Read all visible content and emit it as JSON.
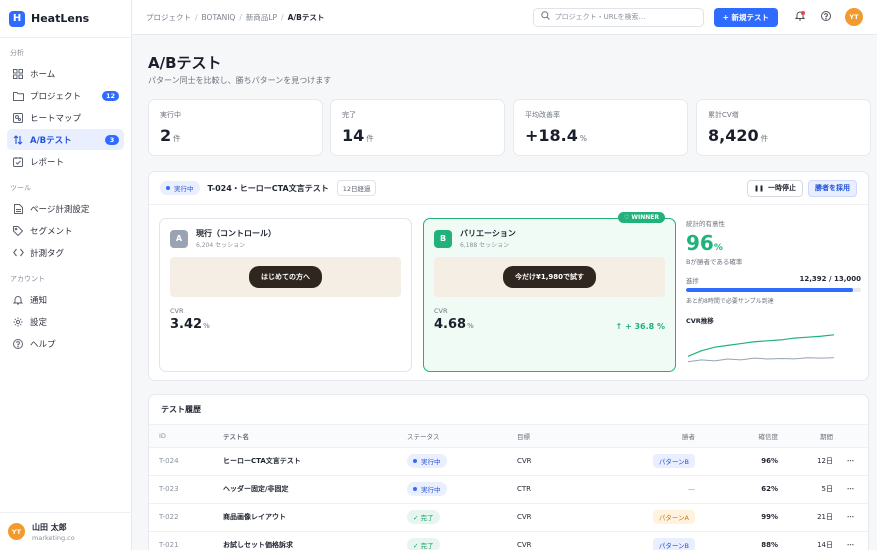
{
  "app": {
    "name": "HeatLens",
    "logo_letter": "H"
  },
  "sidebar": {
    "section_analysis": "分析",
    "section_tools": "ツール",
    "section_account": "アカウント",
    "items": [
      {
        "label": "ホーム",
        "icon": "grid-icon"
      },
      {
        "label": "プロジェクト",
        "icon": "folder-icon",
        "badge": "12"
      },
      {
        "label": "ヒートマップ",
        "icon": "heatmap-icon"
      },
      {
        "label": "A/Bテスト",
        "icon": "ab-swap-icon",
        "badge": "3",
        "active": true
      },
      {
        "label": "レポート",
        "icon": "report-icon"
      },
      {
        "label": "ページ計測設定",
        "icon": "document-icon"
      },
      {
        "label": "セグメント",
        "icon": "tag-icon"
      },
      {
        "label": "計測タグ",
        "icon": "code-icon"
      },
      {
        "label": "通知",
        "icon": "bell-icon"
      },
      {
        "label": "設定",
        "icon": "gear-icon"
      },
      {
        "label": "ヘルプ",
        "icon": "help-icon"
      }
    ],
    "user": {
      "initials": "YT",
      "name": "山田 太郎",
      "org": "marketing.co"
    }
  },
  "topbar": {
    "breadcrumbs": [
      "プロジェクト",
      "BOTANIQ",
      "新商品LP",
      "A/Bテスト"
    ],
    "search_placeholder": "プロジェクト・URLを検索…",
    "new_button": "+ 新規テスト",
    "avatar": "YT"
  },
  "page": {
    "title": "A/Bテスト",
    "subtitle": "パターン同士を比較し、勝ちパターンを見つけます"
  },
  "stats": [
    {
      "label": "実行中",
      "value": "2",
      "unit": "件"
    },
    {
      "label": "完了",
      "value": "14",
      "unit": "件"
    },
    {
      "label": "平均改善率",
      "value": "+18.4",
      "unit": "%"
    },
    {
      "label": "累計CV増",
      "value": "8,420",
      "unit": "件"
    }
  ],
  "experiment": {
    "status": "実行中",
    "title": "T-024・ヒーローCTA文言テスト",
    "days": "12日経過",
    "pause_label": "一時停止",
    "adopt_label": "勝者を採用",
    "cvr_label": "CVR",
    "variants": [
      {
        "tag": "A",
        "name": "現行（コントロール）",
        "sessions": "6,204 セッション",
        "cta": "はじめての方へ",
        "cvr": "3.42",
        "tag_color": "#9aa3b3"
      },
      {
        "tag": "B",
        "name": "バリエーション",
        "sessions": "6,188 セッション",
        "cta": "今だけ¥1,980で試す",
        "cvr": "4.68",
        "lift": "↑ + 36.8 %",
        "winner": "♡ WINNER",
        "tag_color": "#20b27a"
      }
    ],
    "significance_label": "統計的有意性",
    "significance_value": "96",
    "significance_unit": "%",
    "significance_desc": "Bが勝者である確率",
    "progress_label": "進捗",
    "progress_text": "12,392 / 13,000",
    "progress_value": 0.953,
    "progress_note": "あと約8時間で必要サンプル到達",
    "trend_label": "CVR推移"
  },
  "chart_data": {
    "type": "line",
    "title": "CVR推移",
    "x": [
      1,
      2,
      3,
      4,
      5,
      6,
      7,
      8,
      9,
      10,
      11,
      12
    ],
    "series": [
      {
        "values": [
          3.5,
          3.8,
          4.0,
          4.1,
          4.2,
          4.3,
          4.35,
          4.4,
          4.5,
          4.55,
          4.6,
          4.68
        ],
        "color": "#20b27a"
      },
      {
        "values": [
          3.2,
          3.3,
          3.25,
          3.35,
          3.3,
          3.4,
          3.35,
          3.38,
          3.36,
          3.42,
          3.4,
          3.42
        ],
        "color": "#9aa3b3"
      }
    ],
    "ylim": [
      2.8,
      5.0
    ],
    "grid": false
  },
  "history": {
    "title": "テスト履歴",
    "columns": [
      "ID",
      "テスト名",
      "ステータス",
      "目標",
      "勝者",
      "確信度",
      "期間"
    ],
    "rows": [
      {
        "id": "T-024",
        "name": "ヒーローCTA文言テスト",
        "status": "実行中",
        "status_kind": "run",
        "goal": "CVR",
        "winner": "パターンB",
        "winner_kind": "b",
        "confidence": "96%",
        "duration": "12日"
      },
      {
        "id": "T-023",
        "name": "ヘッダー固定/非固定",
        "status": "実行中",
        "status_kind": "run",
        "goal": "CTR",
        "winner": "—",
        "winner_kind": "none",
        "confidence": "62%",
        "duration": "5日"
      },
      {
        "id": "T-022",
        "name": "商品画像レイアウト",
        "status": "✓ 完了",
        "status_kind": "done",
        "goal": "CVR",
        "winner": "パターンA",
        "winner_kind": "a",
        "confidence": "99%",
        "duration": "21日"
      },
      {
        "id": "T-021",
        "name": "お試しセット価格訴求",
        "status": "✓ 完了",
        "status_kind": "done",
        "goal": "CVR",
        "winner": "パターンB",
        "winner_kind": "b",
        "confidence": "88%",
        "duration": "14日"
      }
    ],
    "more_icon": "more-icon"
  }
}
